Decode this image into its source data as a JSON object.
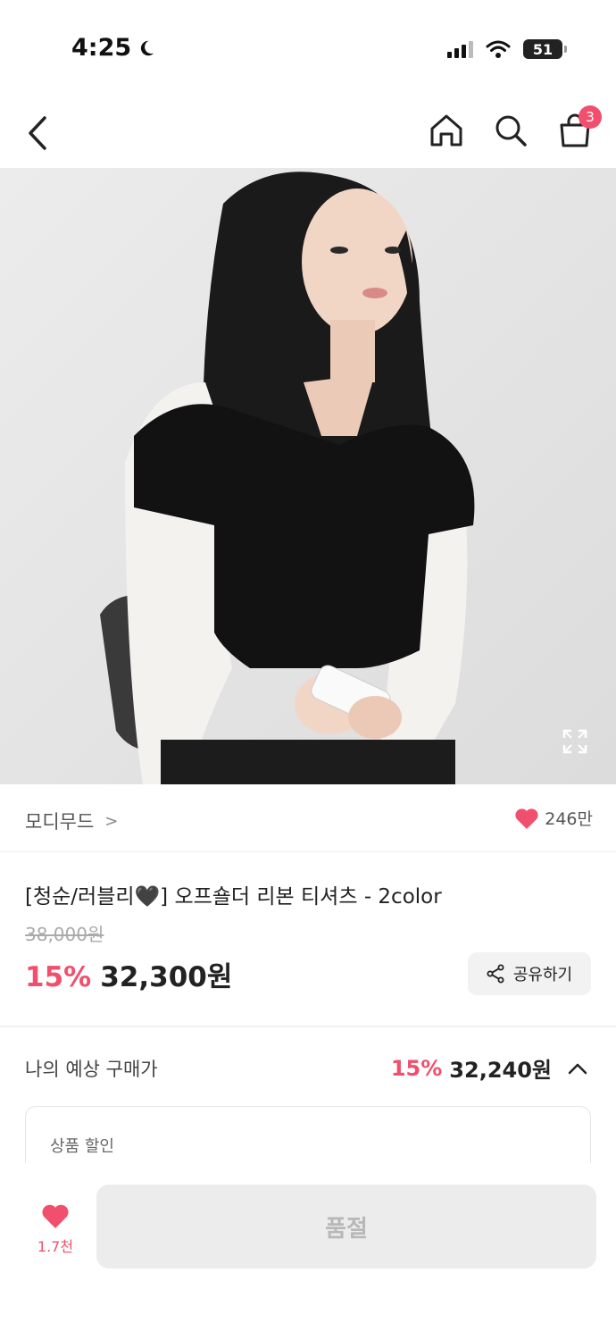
{
  "status_bar": {
    "time": "4:25",
    "battery": "51"
  },
  "nav": {
    "cart_count": "3"
  },
  "brand": {
    "name": "모디무드",
    "chevron": ">",
    "likes": "246만"
  },
  "product": {
    "title": "[청순/러블리🖤] 오프숄더 리본 티셔츠 - 2color",
    "original_price": "38,000원",
    "discount": "15%",
    "price": "32,300원",
    "share_label": "공유하기"
  },
  "expected_price": {
    "label": "나의 예상 구매가",
    "discount": "15%",
    "price": "32,240원",
    "box_label": "상품 할인"
  },
  "bottom_bar": {
    "wish_count": "1.7천",
    "soldout_label": "품절"
  },
  "colors": {
    "accent": "#f0506e",
    "soldout_bg": "#ececec"
  }
}
